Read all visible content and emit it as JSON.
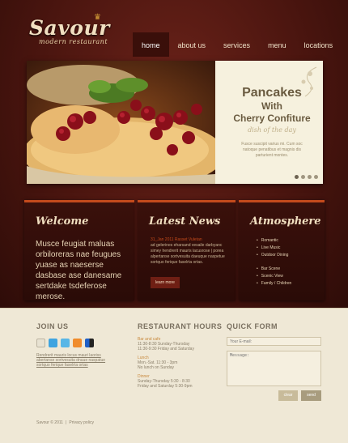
{
  "logo": {
    "name": "Savour",
    "tagline": "modern restaurant"
  },
  "nav": [
    {
      "label": "home",
      "active": true
    },
    {
      "label": "about us",
      "active": false
    },
    {
      "label": "services",
      "active": false
    },
    {
      "label": "menu",
      "active": false
    },
    {
      "label": "locations",
      "active": false
    }
  ],
  "slider": {
    "title": "Pancakes",
    "subtitle1": "With",
    "subtitle2": "Cherry Confiture",
    "dish": "dish of the day",
    "description": "Fusce suscipit varius mi. Cum soc natoque penatibus et magnis dis parturient montes.",
    "active_dot": 1,
    "dots": 4
  },
  "welcome": {
    "title": "Welcome",
    "text": "Musce feugiat maluas orbiloreras nae feugues yuase as naeserse dasbase ase danesame sertdake tsdeferose merose."
  },
  "news": {
    "title": "Latest News",
    "date_line": "31_Jan 2011 Rasset Vuletan",
    "text": "ad gelerines eharsand vesaile darbyanc simey hendrerit mauris lacusrose | porea alpertanse sortvesuita daeuque naspetue sortquo ferique faselrta ortas.",
    "button": "learn more"
  },
  "atmosphere": {
    "title": "Atmosphere",
    "list1": [
      "Romantic",
      "Live Music",
      "Outdoor Dining"
    ],
    "list2": [
      "Bar Scene",
      "Scenic View",
      "Family / Children"
    ]
  },
  "footer": {
    "join_title": "JOIN US",
    "join_text": "Rendrerit mauris locus mauri laoriss abertanse sortvesuita dnuue naspatue sortquo ferique faselrta ortas",
    "hours_title": "RESTAURANT HOURS",
    "hours": [
      {
        "label": "Bar and cafe",
        "lines": [
          "11:30-8:30 Sunday-Thursday",
          "11:30-9:30 Friday and Saturday"
        ]
      },
      {
        "label": "Lunch",
        "lines": [
          "Mon.-Sat. 11:30 - 3pm",
          "No lunch on Sunday"
        ]
      },
      {
        "label": "Dinner",
        "lines": [
          "Sunday-Thursday 5:30 - 8:30",
          "Friday and Saturday 5:30-9pm"
        ]
      }
    ],
    "form_title": "QUICK FORM",
    "email_placeholder": "Your E-mail:",
    "message_placeholder": "Message:",
    "clear": "clear",
    "send": "send",
    "copyright": "Savour © 2011",
    "privacy": "Privacy policy"
  },
  "colors": {
    "accent": "#c44a1c",
    "dark": "#3a100b",
    "cream": "#efe8d6"
  }
}
